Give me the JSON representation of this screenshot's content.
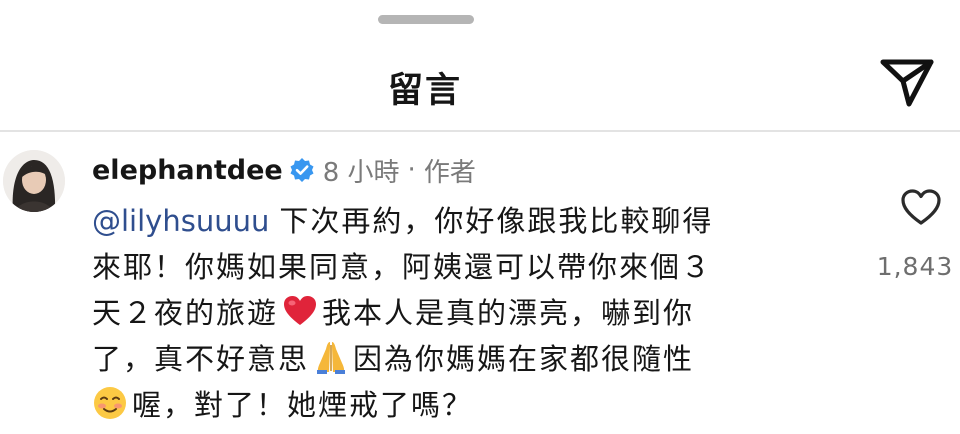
{
  "header": {
    "title": "留言"
  },
  "comment": {
    "username": "elephantdee",
    "time": "8 小時",
    "separator": "·",
    "role": "作者",
    "mention": "@lilyhsuuuu",
    "segments": {
      "line1_text": "下次再約，你好像跟我比較聊得",
      "line2_text": "來耶！你媽如果同意，阿姨還可以帶你來個３",
      "line3_text_a": "天２夜的旅遊",
      "line3_text_b": "我本人是真的漂亮，嚇到你",
      "line4_text_a": "了，真不好意思",
      "line4_text_b": "因為你媽媽在家都很隨性",
      "line5_text": "喔，對了！她煙戒了嗎？"
    },
    "emojis": {
      "heart": "heart-emoji",
      "pray": "folded-hands-emoji",
      "smile": "smiling-face-emoji"
    },
    "likes": "1,843"
  },
  "icons": {
    "share": "paper-plane-icon",
    "like": "heart-outline-icon",
    "verified": "verified-badge-icon"
  },
  "colors": {
    "mention": "#2f4e8e",
    "verified": "#3897f0",
    "meta": "#7a7a7a",
    "heart": "#e0243a"
  }
}
